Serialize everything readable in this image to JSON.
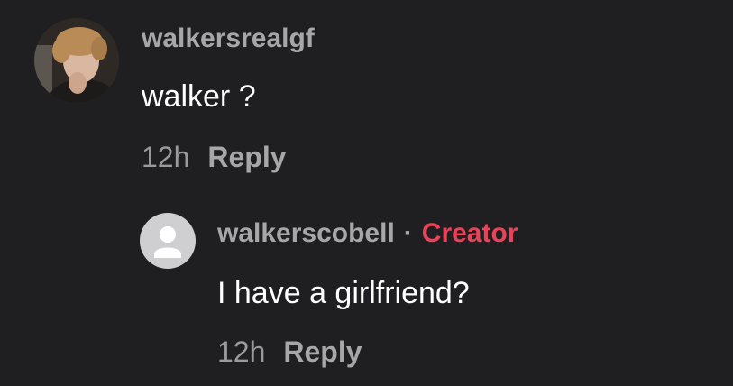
{
  "comments": [
    {
      "username": "walkersrealgf",
      "text": "walker ?",
      "time": "12h",
      "reply_label": "Reply"
    },
    {
      "username": "walkerscobell",
      "separator": "·",
      "badge": "Creator",
      "text": "I have a girlfriend?",
      "time": "12h",
      "reply_label": "Reply"
    }
  ],
  "colors": {
    "background": "#1f1f21",
    "creator_badge": "#e8435a"
  }
}
